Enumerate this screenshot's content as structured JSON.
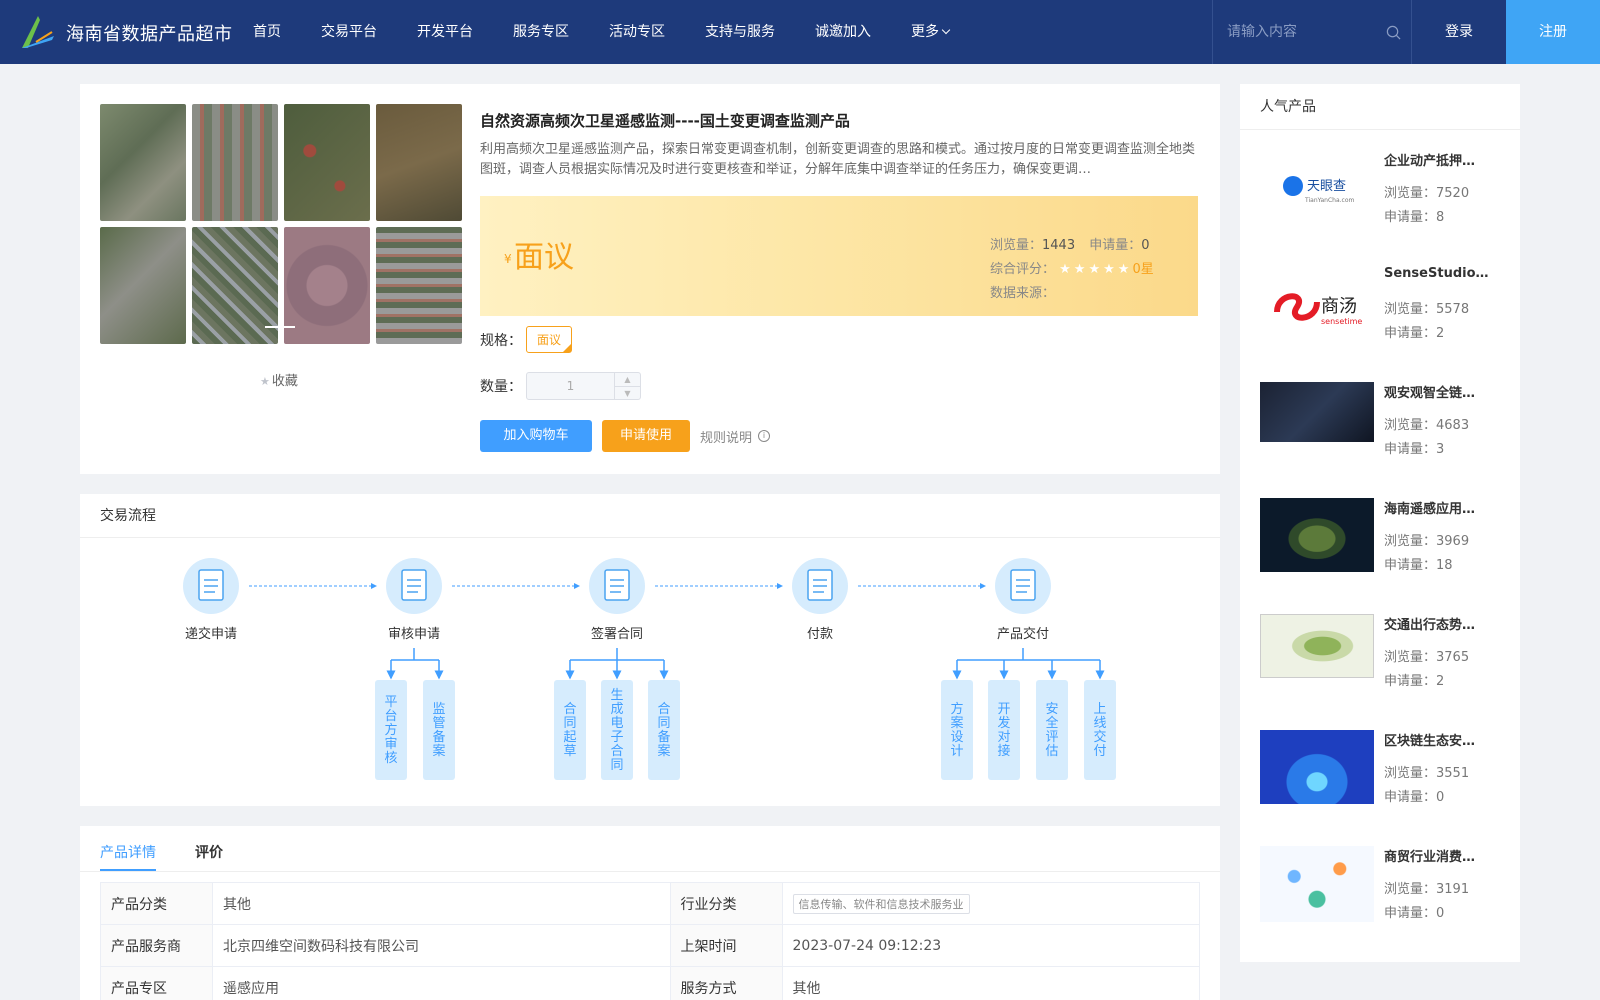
{
  "header": {
    "site_title": "海南省数据产品超市",
    "nav": [
      "首页",
      "交易平台",
      "开发平台",
      "服务专区",
      "活动专区",
      "支持与服务",
      "诚邀加入",
      "更多"
    ],
    "search_placeholder": "请输入内容",
    "login": "登录",
    "register": "注册",
    "colors": {
      "bar": "#1e3a7b",
      "register_bg": "#3fa5f5"
    }
  },
  "product": {
    "title": "自然资源高频次卫星遥感监测----国土变更调查监测产品",
    "description": "利用高频次卫星遥感监测产品，探索日常变更调查机制，创新变更调查的思路和模式。通过按月度的日常变更调查监测全地类图斑，调查人员根据实际情况及时进行变更核查和举证，分解年底集中调查举证的任务压力，确保变更调…",
    "favorite": "收藏",
    "price_symbol": "¥",
    "price": "面议",
    "views_label": "浏览量：",
    "views": "1443",
    "applications_label": "申请量：",
    "applications": "0",
    "rating_label": "综合评分：",
    "rating_stars": "★★★★★",
    "rating_text": "0星",
    "source_label": "数据来源：",
    "spec_label": "规格：",
    "spec_value": "面议",
    "qty_label": "数量：",
    "qty_value": "1",
    "add_cart": "加入购物车",
    "apply": "申请使用",
    "rules": "规则说明",
    "colors": {
      "accent": "#f7a11b",
      "primary": "#409eff"
    }
  },
  "flow": {
    "title": "交易流程",
    "steps": [
      "递交申请",
      "审核申请",
      "签署合同",
      "付款",
      "产品交付"
    ],
    "sub_steps": {
      "审核申请": [
        "平台方审核",
        "监管备案"
      ],
      "签署合同": [
        "合同起草",
        "生成电子合同",
        "合同备案"
      ],
      "产品交付": [
        "方案设计",
        "开发对接",
        "安全评估",
        "上线交付"
      ]
    }
  },
  "details": {
    "tabs": [
      "产品详情",
      "评价"
    ],
    "rows": [
      {
        "label1": "产品分类",
        "value1": "其他",
        "label2": "行业分类",
        "value2": "信息传输、软件和信息技术服务业"
      },
      {
        "label1": "产品服务商",
        "value1": "北京四维空间数码科技有限公司",
        "label2": "上架时间",
        "value2": "2023-07-24 09:12:23"
      },
      {
        "label1": "产品专区",
        "value1": "遥感应用",
        "label2": "服务方式",
        "value2": "其他"
      }
    ]
  },
  "sidebar": {
    "title": "人气产品",
    "views_label": "浏览量：",
    "apps_label": "申请量：",
    "logo_text": {
      "tianyancha_cn": "天眼查",
      "tianyancha_en": "TianYanCha.com",
      "sensetime_cn": "商汤",
      "sensetime_en": "sensetime"
    },
    "items": [
      {
        "title": "企业动产抵押…",
        "views": "7520",
        "apps": "8"
      },
      {
        "title": "SenseStudio…",
        "views": "5578",
        "apps": "2"
      },
      {
        "title": "观安观智全链…",
        "views": "4683",
        "apps": "3"
      },
      {
        "title": "海南遥感应用…",
        "views": "3969",
        "apps": "18"
      },
      {
        "title": "交通出行态势…",
        "views": "3765",
        "apps": "2"
      },
      {
        "title": "区块链生态安…",
        "views": "3551",
        "apps": "0"
      },
      {
        "title": "商贸行业消费…",
        "views": "3191",
        "apps": "0"
      }
    ]
  }
}
